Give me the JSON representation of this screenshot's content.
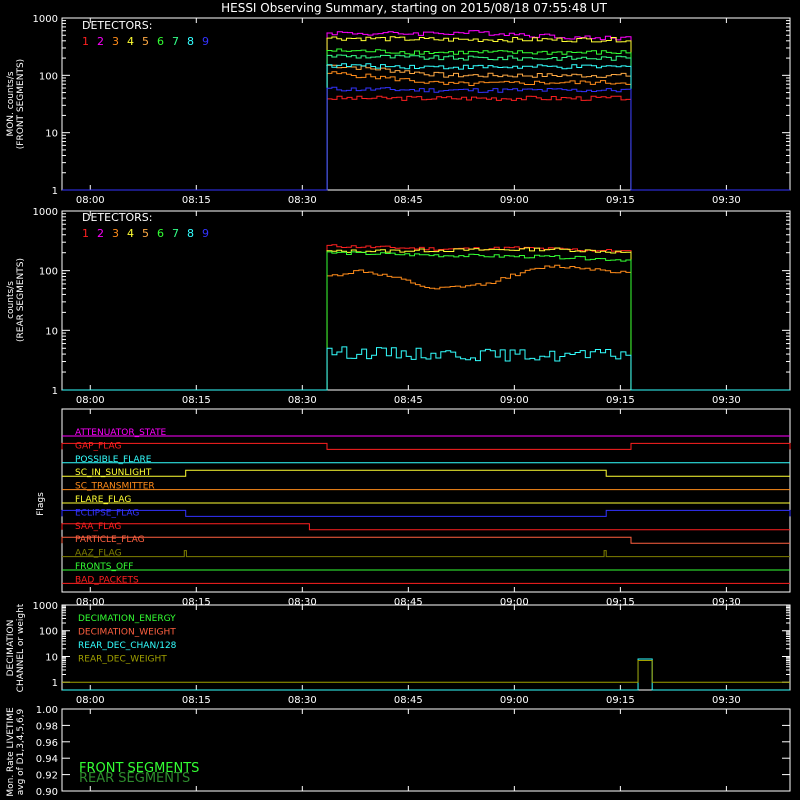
{
  "title": "HESSI Observing Summary, starting on 2015/08/18 07:55:48 UT",
  "colors": {
    "det": [
      "#ff2020",
      "#ff00ff",
      "#ff8c1a",
      "#ffff33",
      "#ffaa44",
      "#33ff33",
      "#33ff88",
      "#33ffff",
      "#3333ff"
    ],
    "axis": "#ffffff"
  },
  "time_axis": {
    "start_min": 476,
    "end_min": 579,
    "ticks": [
      {
        "t": 480,
        "label": "08:00"
      },
      {
        "t": 495,
        "label": "08:15"
      },
      {
        "t": 510,
        "label": "08:30"
      },
      {
        "t": 525,
        "label": "08:45"
      },
      {
        "t": 540,
        "label": "09:00"
      },
      {
        "t": 555,
        "label": "09:15"
      },
      {
        "t": 570,
        "label": "09:30"
      }
    ]
  },
  "legend": {
    "header": "DETECTORS:",
    "numbers": [
      "1",
      "2",
      "3",
      "4",
      "5",
      "6",
      "7",
      "8",
      "9"
    ]
  },
  "chart_data": [
    {
      "id": "front",
      "type": "line",
      "scale": "log",
      "ylabel": [
        "MON. counts/s",
        "(FRONT SEGMENTS)"
      ],
      "ylim": [
        1,
        1000
      ],
      "yticks": [
        "1",
        "10",
        "100",
        "1000"
      ],
      "on_start": 513.5,
      "on_end": 556.5,
      "series": [
        {
          "det": 1,
          "color": "#ff2020",
          "values": [
            {
              "t": 476,
              "y": 1
            },
            {
              "t": 513.5,
              "y": 40
            },
            {
              "t": 556.5,
              "y": 1
            },
            {
              "t": 579,
              "y": 1
            }
          ]
        },
        {
          "det": 2,
          "color": "#ff00ff",
          "values": [
            {
              "t": 476,
              "y": 1
            },
            {
              "t": 513.5,
              "y": 560
            },
            {
              "t": 520,
              "y": 530
            },
            {
              "t": 535,
              "y": 560
            },
            {
              "t": 550,
              "y": 450
            },
            {
              "t": 556.5,
              "y": 1
            }
          ]
        },
        {
          "det": 3,
          "color": "#ff8c1a",
          "values": [
            {
              "t": 476,
              "y": 1
            },
            {
              "t": 513.5,
              "y": 110
            },
            {
              "t": 530,
              "y": 70
            },
            {
              "t": 545,
              "y": 75
            },
            {
              "t": 556.5,
              "y": 1
            }
          ]
        },
        {
          "det": 4,
          "color": "#ffff33",
          "values": [
            {
              "t": 476,
              "y": 1
            },
            {
              "t": 513.5,
              "y": 450
            },
            {
              "t": 530,
              "y": 420
            },
            {
              "t": 556.5,
              "y": 1
            }
          ]
        },
        {
          "det": 5,
          "color": "#ffaa44",
          "values": [
            {
              "t": 476,
              "y": 1
            },
            {
              "t": 513.5,
              "y": 150
            },
            {
              "t": 530,
              "y": 100
            },
            {
              "t": 556.5,
              "y": 1
            }
          ]
        },
        {
          "det": 6,
          "color": "#33ff33",
          "values": [
            {
              "t": 476,
              "y": 1
            },
            {
              "t": 513.5,
              "y": 270
            },
            {
              "t": 530,
              "y": 250
            },
            {
              "t": 556.5,
              "y": 1
            }
          ]
        },
        {
          "det": 7,
          "color": "#33ff88",
          "values": [
            {
              "t": 476,
              "y": 1
            },
            {
              "t": 513.5,
              "y": 220
            },
            {
              "t": 530,
              "y": 200
            },
            {
              "t": 556.5,
              "y": 1
            }
          ]
        },
        {
          "det": 8,
          "color": "#33ffff",
          "values": [
            {
              "t": 476,
              "y": 1
            },
            {
              "t": 513.5,
              "y": 150
            },
            {
              "t": 530,
              "y": 140
            },
            {
              "t": 556.5,
              "y": 1
            }
          ]
        },
        {
          "det": 9,
          "color": "#3333ff",
          "values": [
            {
              "t": 476,
              "y": 1
            },
            {
              "t": 513.5,
              "y": 58
            },
            {
              "t": 530,
              "y": 55
            },
            {
              "t": 556.5,
              "y": 1
            }
          ]
        }
      ]
    },
    {
      "id": "rear",
      "type": "line",
      "scale": "log",
      "ylabel": [
        "counts/s",
        "(REAR SEGMENTS)"
      ],
      "ylim": [
        1,
        1000
      ],
      "yticks": [
        "1",
        "10",
        "100",
        "1000"
      ],
      "on_start": 513.5,
      "on_end": 556.5,
      "series": [
        {
          "det": 1,
          "color": "#ff2020",
          "values": [
            {
              "t": 513.5,
              "y": 260
            },
            {
              "t": 530,
              "y": 230
            },
            {
              "t": 540,
              "y": 240
            },
            {
              "t": 556.5,
              "y": 210
            }
          ]
        },
        {
          "det": 3,
          "color": "#ff8c1a",
          "values": [
            {
              "t": 513.5,
              "y": 80
            },
            {
              "t": 518,
              "y": 100
            },
            {
              "t": 524,
              "y": 70
            },
            {
              "t": 528,
              "y": 48
            },
            {
              "t": 536,
              "y": 60
            },
            {
              "t": 545,
              "y": 120
            },
            {
              "t": 550,
              "y": 110
            },
            {
              "t": 556.5,
              "y": 90
            }
          ]
        },
        {
          "det": 4,
          "color": "#ffff33",
          "values": [
            {
              "t": 513.5,
              "y": 210
            },
            {
              "t": 530,
              "y": 220
            },
            {
              "t": 545,
              "y": 230
            },
            {
              "t": 556.5,
              "y": 200
            }
          ]
        },
        {
          "det": 6,
          "color": "#33ff33",
          "values": [
            {
              "t": 513.5,
              "y": 200
            },
            {
              "t": 530,
              "y": 180
            },
            {
              "t": 545,
              "y": 170
            },
            {
              "t": 556.5,
              "y": 150
            }
          ]
        },
        {
          "det": 8,
          "color": "#33ffff",
          "values": [
            {
              "t": 513.5,
              "y": 4.4
            },
            {
              "t": 545,
              "y": 3.8
            },
            {
              "t": 556.5,
              "y": 4
            }
          ]
        }
      ]
    },
    {
      "id": "flags",
      "type": "step",
      "ylabel": [
        "Flags"
      ],
      "flags": [
        {
          "name": "ATTENUATOR_STATE",
          "color": "#ff00ff",
          "high_intervals": []
        },
        {
          "name": "GAP_FLAG",
          "color": "#ff2020",
          "high_intervals": [
            [
              476,
              513.5
            ],
            [
              556.5,
              579
            ]
          ]
        },
        {
          "name": "POSSIBLE_FLARE",
          "color": "#33ffff",
          "high_intervals": []
        },
        {
          "name": "SC_IN_SUNLIGHT",
          "color": "#ffff33",
          "high_intervals": [
            [
              493.5,
              553
            ]
          ]
        },
        {
          "name": "SC_TRANSMITTER",
          "color": "#ff8c1a",
          "high_intervals": []
        },
        {
          "name": "FLARE_FLAG",
          "color": "#ffff33",
          "high_intervals": []
        },
        {
          "name": "ECLIPSE_FLAG",
          "color": "#3333ff",
          "high_intervals": [
            [
              476,
              493.5
            ],
            [
              553,
              579
            ]
          ]
        },
        {
          "name": "SAA_FLAG",
          "color": "#ff2020",
          "high_intervals": [
            [
              476,
              511
            ]
          ]
        },
        {
          "name": "PARTICLE_FLAG",
          "color": "#ff6040",
          "high_intervals": [
            [
              476,
              556.5
            ]
          ]
        },
        {
          "name": "AAZ_FLAG",
          "color": "#808000",
          "high_intervals": [
            [
              493.3,
              493.6
            ],
            [
              552.7,
              553
            ]
          ]
        },
        {
          "name": "FRONTS_OFF",
          "color": "#33ff33",
          "high_intervals": []
        },
        {
          "name": "BAD_PACKETS",
          "color": "#ff2020",
          "high_intervals": []
        }
      ]
    },
    {
      "id": "decimation",
      "type": "step",
      "scale": "log",
      "ylabel": [
        "DECIMATION",
        "CHANNEL or weight"
      ],
      "ylim": [
        0.5,
        1000
      ],
      "yticks": [
        "1",
        "10",
        "100",
        "1000"
      ],
      "series": [
        {
          "name": "DECIMATION_ENERGY",
          "color": "#33ff33",
          "values": []
        },
        {
          "name": "DECIMATION_WEIGHT",
          "color": "#ff6040",
          "values": []
        },
        {
          "name": "REAR_DEC_CHAN/128",
          "color": "#33ffff",
          "values": [
            {
              "t": 476,
              "y": 0
            },
            {
              "t": 557.5,
              "y": 8
            },
            {
              "t": 559.5,
              "y": 0
            }
          ]
        },
        {
          "name": "REAR_DEC_WEIGHT",
          "color": "#a0a000",
          "values": [
            {
              "t": 476,
              "y": 1
            },
            {
              "t": 557.5,
              "y": 7
            },
            {
              "t": 559.5,
              "y": 1
            }
          ]
        }
      ]
    },
    {
      "id": "livetime",
      "type": "line",
      "ylabel": [
        "Mon. Rate LIVETIME",
        "avg of D1,3,4,5,6,9"
      ],
      "ylim": [
        0.9,
        1.0
      ],
      "yticks": [
        "0.90",
        "0.92",
        "0.94",
        "0.96",
        "0.98",
        "1.00"
      ],
      "series": [
        {
          "name": "FRONT SEGMENTS",
          "color": "#33ff33",
          "values": []
        },
        {
          "name": "REAR SEGMENTS",
          "color": "#2e8b2e",
          "values": []
        }
      ]
    }
  ]
}
